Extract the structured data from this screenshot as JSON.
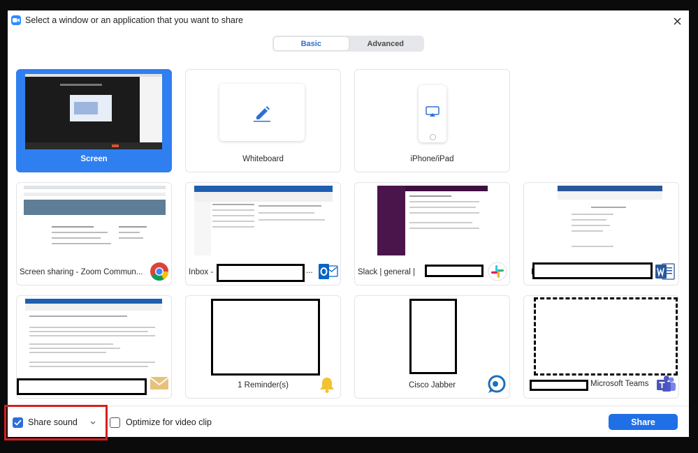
{
  "dialog": {
    "title": "Select a window or an application that you want to share"
  },
  "tabs": [
    {
      "label": "Basic",
      "active": true
    },
    {
      "label": "Advanced",
      "active": false
    }
  ],
  "tiles": [
    {
      "label": "Screen",
      "selected": true
    },
    {
      "label": "Whiteboard"
    },
    {
      "label": "iPhone/iPad"
    },
    {
      "label": "Screen sharing - Zoom Commun...",
      "app_icon": "chrome-icon"
    },
    {
      "label": "Inbox -",
      "suffix": "...",
      "app_icon": "outlook-icon"
    },
    {
      "label": "Slack | general |",
      "app_icon": "slack-icon"
    },
    {
      "label": "F",
      "app_icon": "word-icon"
    },
    {
      "label": "",
      "app_icon": "mail-icon"
    },
    {
      "label": "1 Reminder(s)",
      "app_icon": "bell-icon"
    },
    {
      "label": "Cisco Jabber",
      "app_icon": "jabber-icon"
    },
    {
      "label": "Microsoft Teams",
      "app_icon": "teams-icon"
    }
  ],
  "bottom": {
    "share_sound_label": "Share sound",
    "share_sound_checked": true,
    "optimize_label": "Optimize for video clip",
    "optimize_checked": false,
    "share_button": "Share"
  },
  "colors": {
    "accent": "#2d6fd8",
    "selected_tile": "#2f7ff1",
    "highlight_outline": "#d61f1f"
  }
}
